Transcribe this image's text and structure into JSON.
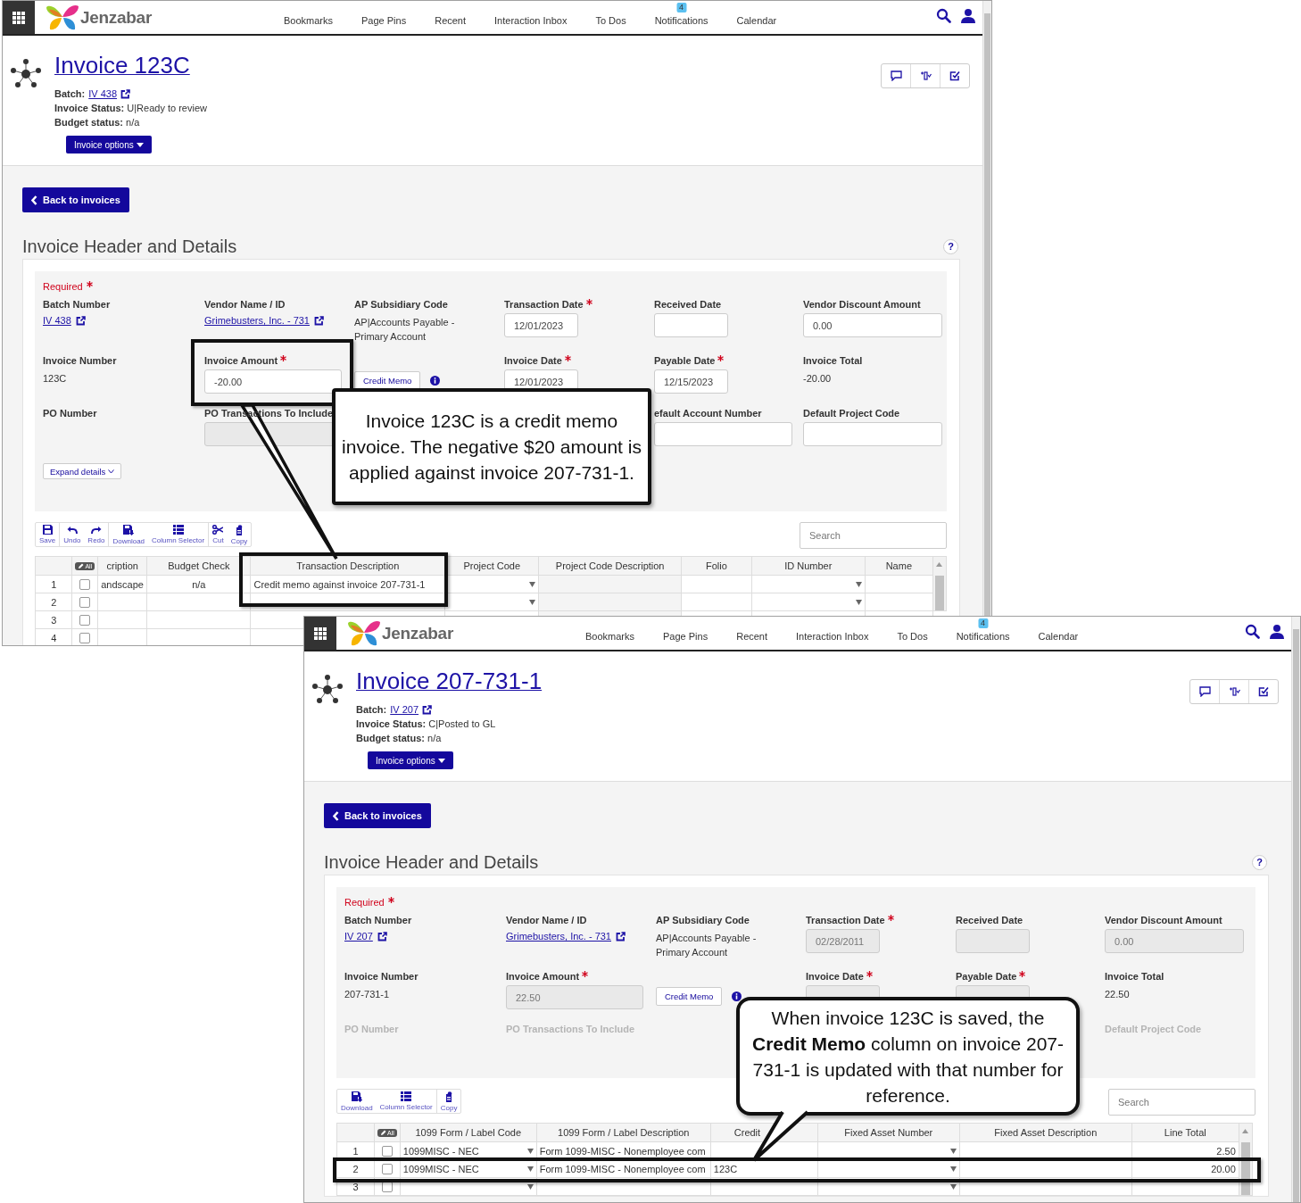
{
  "windows": [
    {
      "nav": {
        "logo": "Jenzabar",
        "items": [
          {
            "label": "Bookmarks"
          },
          {
            "label": "Page Pins"
          },
          {
            "label": "Recent"
          },
          {
            "label": "Interaction Inbox"
          },
          {
            "label": "To Dos"
          },
          {
            "label": "Notifications",
            "badge": "4"
          },
          {
            "label": "Calendar"
          }
        ]
      },
      "title": "Invoice 123C",
      "meta": [
        {
          "kind": "link",
          "label": "Batch:",
          "value": "IV 438"
        },
        {
          "kind": "text",
          "text": "**Invoice Status:** U|Ready to review"
        },
        {
          "kind": "text",
          "text": "**Budget status:** n/a"
        }
      ],
      "options_button": "Invoice options",
      "back_button": "Back to invoices",
      "section_title": "Invoice Header and Details",
      "help": "?",
      "required_label": "Required",
      "fields": [
        {
          "kind": "link",
          "label": "Batch Number",
          "required": false,
          "value": "IV 438"
        },
        {
          "kind": "link",
          "label": "Vendor Name / ID",
          "required": false,
          "value": "Grimebusters, Inc. - 731"
        },
        {
          "kind": "text",
          "label": "AP Subsidiary Code",
          "required": false,
          "value": "AP|Accounts Payable - Primary Account"
        },
        {
          "kind": "input",
          "label": "Transaction Date",
          "required": true,
          "value": "12/01/2023",
          "disabled": false
        },
        {
          "kind": "input",
          "label": "Received Date",
          "required": false,
          "disabled": false
        },
        {
          "kind": "input",
          "label": "Vendor Discount Amount",
          "required": false,
          "value": "0.00",
          "disabled": false
        },
        {
          "kind": "text",
          "label": "Invoice Number",
          "required": false,
          "value": "123C"
        },
        {
          "kind": "input",
          "label": "Invoice Amount",
          "required": true,
          "value": "-20.00",
          "disabled": false
        },
        {
          "kind": "button",
          "label_button": "Credit Memo"
        },
        {
          "kind": "input",
          "label": "Invoice Date",
          "required": true,
          "value": "12/01/2023",
          "disabled": false
        },
        {
          "kind": "input",
          "label": "Payable Date",
          "required": true,
          "value": "12/15/2023",
          "disabled": false
        },
        {
          "kind": "text",
          "label": "Invoice Total",
          "required": false,
          "value": "-20.00"
        },
        {
          "kind": "label",
          "label": "PO Number",
          "required": false
        },
        {
          "kind": "select",
          "label": "PO Transactions To Include",
          "required": false,
          "disabled": true
        },
        {
          "kind": "blank"
        },
        {
          "kind": "blank"
        },
        {
          "kind": "input",
          "label": "efault Account Number",
          "required": false,
          "disabled": false
        },
        {
          "kind": "input",
          "label": "Default Project Code",
          "required": false,
          "disabled": false
        }
      ],
      "expand_button": "Expand details",
      "faded_last_row": false,
      "toolbar": [
        {
          "kind": "save",
          "label": "Save",
          "separated": false
        },
        {
          "kind": "undo",
          "label": "Undo",
          "separated": true
        },
        {
          "kind": "redo",
          "label": "Redo",
          "separated": false
        },
        {
          "kind": "download",
          "label": "Download",
          "separated": true
        },
        {
          "kind": "columns",
          "label": "Column Selector",
          "separated": false
        },
        {
          "kind": "cut",
          "label": "Cut",
          "separated": true
        },
        {
          "kind": "copy",
          "label": "Copy",
          "separated": false
        }
      ],
      "search": {
        "placeholder": "Search"
      },
      "table": {
        "select_all": "All",
        "columns": [
          {
            "label": "cription",
            "dropdown": false,
            "readonly": false
          },
          {
            "label": "Budget Check",
            "dropdown": false,
            "readonly": false
          },
          {
            "label": "Transaction Description",
            "dropdown": false,
            "readonly": false
          },
          {
            "label": "Project Code",
            "dropdown": true,
            "readonly": false
          },
          {
            "label": "Project Code Description",
            "dropdown": false,
            "readonly": true
          },
          {
            "label": "Folio",
            "dropdown": false,
            "readonly": false
          },
          {
            "label": "ID Number",
            "dropdown": true,
            "readonly": false
          },
          {
            "label": "Name",
            "dropdown": false,
            "readonly": false
          }
        ],
        "rows": [
          {
            "number": "1",
            "checked": false,
            "cells": [
              "andscape",
              "n/a",
              "Credit memo against invoice 207-731-1",
              null,
              null,
              null,
              null,
              null
            ]
          },
          {
            "number": "2",
            "checked": false,
            "cells": [
              null,
              null,
              null,
              null,
              null,
              null,
              null,
              null
            ]
          },
          {
            "number": "3",
            "checked": false,
            "cells": [
              null,
              null,
              null,
              null,
              null,
              null,
              null,
              null
            ]
          },
          {
            "number": "4",
            "checked": false,
            "cells": [
              null,
              null,
              null,
              null,
              null,
              null,
              null,
              null
            ]
          }
        ]
      }
    },
    {
      "nav": {
        "logo": "Jenzabar",
        "items": [
          {
            "label": "Bookmarks"
          },
          {
            "label": "Page Pins"
          },
          {
            "label": "Recent"
          },
          {
            "label": "Interaction Inbox"
          },
          {
            "label": "To Dos"
          },
          {
            "label": "Notifications",
            "badge": "4"
          },
          {
            "label": "Calendar"
          }
        ]
      },
      "title": "Invoice 207-731-1",
      "meta": [
        {
          "kind": "link",
          "label": "Batch:",
          "value": "IV 207"
        },
        {
          "kind": "text",
          "text": "**Invoice Status:** C|Posted to GL"
        },
        {
          "kind": "text",
          "text": "**Budget status:** n/a"
        }
      ],
      "options_button": "Invoice options",
      "back_button": "Back to invoices",
      "section_title": "Invoice Header and Details",
      "help": "?",
      "required_label": "Required",
      "fields": [
        {
          "kind": "link",
          "label": "Batch Number",
          "required": false,
          "value": "IV 207"
        },
        {
          "kind": "link",
          "label": "Vendor Name / ID",
          "required": false,
          "value": "Grimebusters, Inc. - 731"
        },
        {
          "kind": "text",
          "label": "AP Subsidiary Code",
          "required": false,
          "value": "AP|Accounts Payable - Primary Account"
        },
        {
          "kind": "input",
          "label": "Transaction Date",
          "required": true,
          "value": "02/28/2011",
          "disabled": true
        },
        {
          "kind": "input",
          "label": "Received Date",
          "required": false,
          "disabled": true
        },
        {
          "kind": "input",
          "label": "Vendor Discount Amount",
          "required": false,
          "value": "0.00",
          "disabled": true
        },
        {
          "kind": "text",
          "label": "Invoice Number",
          "required": false,
          "value": "207-731-1"
        },
        {
          "kind": "input",
          "label": "Invoice Amount",
          "required": true,
          "value": "22.50",
          "disabled": true
        },
        {
          "kind": "button",
          "label_button": "Credit Memo"
        },
        {
          "kind": "input",
          "label": "Invoice Date",
          "required": true,
          "disabled": true
        },
        {
          "kind": "input",
          "label": "Payable Date",
          "required": true,
          "disabled": true
        },
        {
          "kind": "text",
          "label": "Invoice Total",
          "required": false,
          "value": "22.50"
        },
        {
          "kind": "label",
          "label": "PO Number",
          "required": false
        },
        {
          "kind": "label",
          "label": "PO Transactions To Include",
          "required": false
        },
        {
          "kind": "blank"
        },
        {
          "kind": "blank"
        },
        {
          "kind": "blank"
        },
        {
          "kind": "label",
          "label": "Default Project Code",
          "required": false
        }
      ],
      "faded_last_row": true,
      "toolbar": [
        {
          "kind": "download",
          "label": "Download",
          "separated": false
        },
        {
          "kind": "columns",
          "label": "Column Selector",
          "separated": false
        },
        {
          "kind": "copy",
          "label": "Copy",
          "separated": true
        }
      ],
      "search": {
        "placeholder": "Search"
      },
      "table": {
        "select_all": "All",
        "columns": [
          {
            "label": "1099 Form / Label Code",
            "dropdown": true,
            "readonly": false
          },
          {
            "label": "1099 Form / Label Description",
            "dropdown": false,
            "readonly": false
          },
          {
            "label": "Credit",
            "dropdown": false,
            "readonly": false
          },
          {
            "label": "Fixed Asset Number",
            "dropdown": true,
            "readonly": false
          },
          {
            "label": "Fixed Asset Description",
            "dropdown": false,
            "readonly": false
          },
          {
            "label": "Line Total",
            "dropdown": false,
            "readonly": false
          }
        ],
        "rows": [
          {
            "number": "1",
            "checked": false,
            "cells": [
              "1099MISC - NEC",
              "Form 1099-MISC - Nonemployee com",
              null,
              null,
              null,
              "2.50"
            ]
          },
          {
            "number": "2",
            "checked": false,
            "cells": [
              "1099MISC - NEC",
              "Form 1099-MISC - Nonemployee com",
              "123C",
              null,
              null,
              "20.00"
            ]
          },
          {
            "number": "3",
            "checked": false,
            "cells": [
              null,
              null,
              null,
              null,
              null,
              null
            ]
          }
        ]
      }
    }
  ],
  "callouts": [
    {
      "text": "Invoice 123C is a credit memo invoice. The negative $20 amount is applied against invoice 207-731-1."
    },
    {
      "text": "When invoice 123C is saved, the **Credit Memo** column on invoice 207-731-1 is updated with that number for reference."
    }
  ]
}
